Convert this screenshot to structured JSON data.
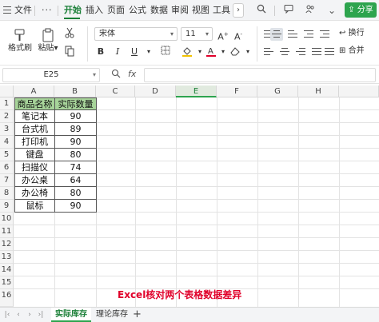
{
  "menubar": {
    "file_label": "文件",
    "tabs": [
      "开始",
      "插入",
      "页面",
      "公式",
      "数据",
      "审阅",
      "视图",
      "工具"
    ],
    "share_label": "分享"
  },
  "ribbon": {
    "format_painter": "格式刷",
    "paste": "粘贴",
    "font_name": "宋体",
    "font_size": "11",
    "wrap": "换行",
    "merge": "合并"
  },
  "formula_bar": {
    "name_box": "E25",
    "fx_label": "fx",
    "value": ""
  },
  "columns": [
    "A",
    "B",
    "C",
    "D",
    "E",
    "F",
    "G",
    "H"
  ],
  "rows": [
    "1",
    "2",
    "3",
    "4",
    "5",
    "6",
    "7",
    "8",
    "9",
    "10",
    "11",
    "12",
    "13",
    "14",
    "15",
    "16"
  ],
  "table": {
    "headers": [
      "商品名称",
      "实际数量"
    ],
    "rows": [
      [
        "笔记本",
        "90"
      ],
      [
        "台式机",
        "89"
      ],
      [
        "打印机",
        "90"
      ],
      [
        "键盘",
        "80"
      ],
      [
        "扫描仪",
        "74"
      ],
      [
        "办公桌",
        "64"
      ],
      [
        "办公椅",
        "80"
      ],
      [
        "鼠标",
        "90"
      ]
    ]
  },
  "caption": "Excel核对两个表格数据差异",
  "sheets": [
    "实际库存",
    "理论库存"
  ],
  "colors": {
    "accent": "#1a7f37",
    "header_fill": "#a7d49a",
    "caption": "#e0002a"
  }
}
